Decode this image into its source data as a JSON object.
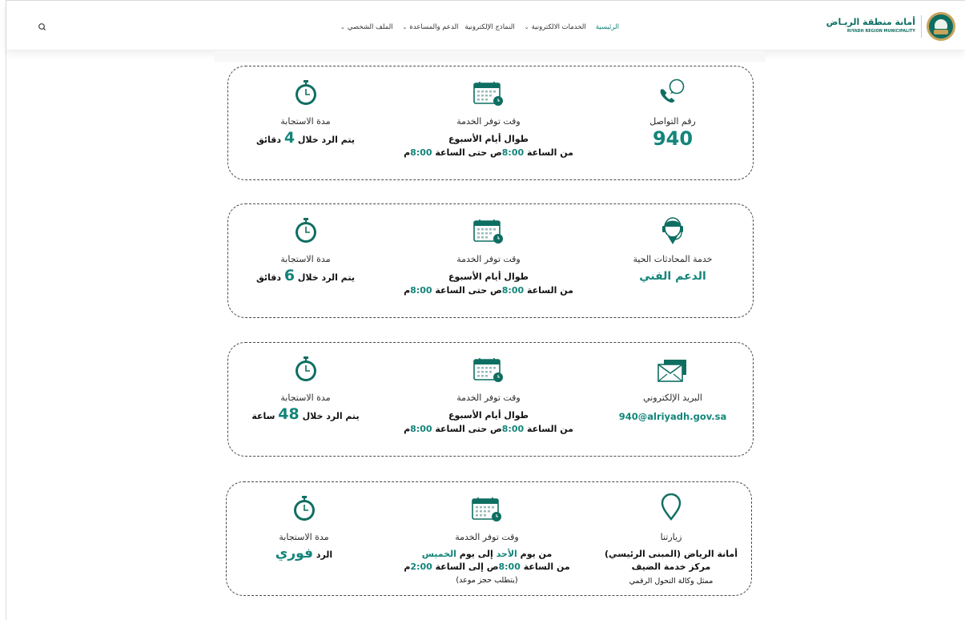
{
  "header": {
    "logo_ar": "أمانة منطقة الريـاض",
    "logo_en": "RIYADH REGION MUNICIPALITY",
    "nav": [
      {
        "label": "الرئيسية",
        "active": true,
        "dropdown": false
      },
      {
        "label": "الخدمات الالكترونية",
        "active": false,
        "dropdown": true
      },
      {
        "label": "النماذج الإلكترونية",
        "active": false,
        "dropdown": false
      },
      {
        "label": "الدعم والمساعدة",
        "active": false,
        "dropdown": true
      },
      {
        "label": "الملف الشخصي",
        "active": false,
        "dropdown": true
      }
    ],
    "search_icon": "search-icon"
  },
  "colors": {
    "accent": "#13857a",
    "brand": "#0f6e62",
    "gold": "#c8a35a"
  },
  "cards": [
    {
      "contact": {
        "icon": "phone-icon",
        "label": "رقم التواصل",
        "value": "940"
      },
      "availability": {
        "icon": "calendar-icon",
        "label": "وقت توفر الخدمة",
        "line1": "طوال أيام الأسبوع",
        "line2_pre": "من الساعة ",
        "time1": "8:00",
        "mid": "ص حتى الساعة ",
        "time2": "8:00",
        "post": "م"
      },
      "response": {
        "icon": "stopwatch-icon",
        "label": "مدة الاستجابة",
        "pre": "يتم الرد خلال ",
        "value": "4",
        "post": " دقائق"
      }
    },
    {
      "contact": {
        "icon": "agent-headset-icon",
        "label": "خدمة المحادثات الحية",
        "value": "الدعم الفني"
      },
      "availability": {
        "icon": "calendar-icon",
        "label": "وقت توفر الخدمة",
        "line1": "طوال أيام الأسبوع",
        "line2_pre": "من الساعة ",
        "time1": "8:00",
        "mid": "ص حتى الساعة ",
        "time2": "8:00",
        "post": "م"
      },
      "response": {
        "icon": "stopwatch-icon",
        "label": "مدة الاستجابة",
        "pre": "يتم الرد خلال ",
        "value": "6",
        "post": " دقائق"
      }
    },
    {
      "contact": {
        "icon": "envelope-icon",
        "label": "البريد الإلكتروني",
        "value": "940@alriyadh.gov.sa"
      },
      "availability": {
        "icon": "calendar-icon",
        "label": "وقت توفر الخدمة",
        "line1": "طوال أيام الأسبوع",
        "line2_pre": "من الساعة ",
        "time1": "8:00",
        "mid": "ص حتى الساعة ",
        "time2": "8:00",
        "post": "م"
      },
      "response": {
        "icon": "stopwatch-icon",
        "label": "مدة الاستجابة",
        "pre": "يتم الرد خلال ",
        "value": "48",
        "post": " ساعة"
      }
    },
    {
      "contact": {
        "icon": "location-pin-icon",
        "label": "زيارتنا",
        "line1": "أمانة الرياض (المبنى الرئيسي)",
        "line2": "مركز خدمة الضيف",
        "line3": "ممثل وكالة التحول الرقمي"
      },
      "availability": {
        "icon": "calendar-icon",
        "label": "وقت توفر الخدمة",
        "d_pre": "من يوم ",
        "day1": "الأحد",
        "d_mid": " إلى يوم ",
        "day2": "الخميس",
        "line2_pre": "من الساعة ",
        "time1": "8:00",
        "mid": "ص إلى الساعة ",
        "time2": "2:00",
        "post": "م",
        "note": "(يتطلب حجز موعد)"
      },
      "response": {
        "icon": "stopwatch-icon",
        "label": "مدة الاستجابة",
        "pre": "الرد ",
        "value": "فوري"
      }
    }
  ]
}
